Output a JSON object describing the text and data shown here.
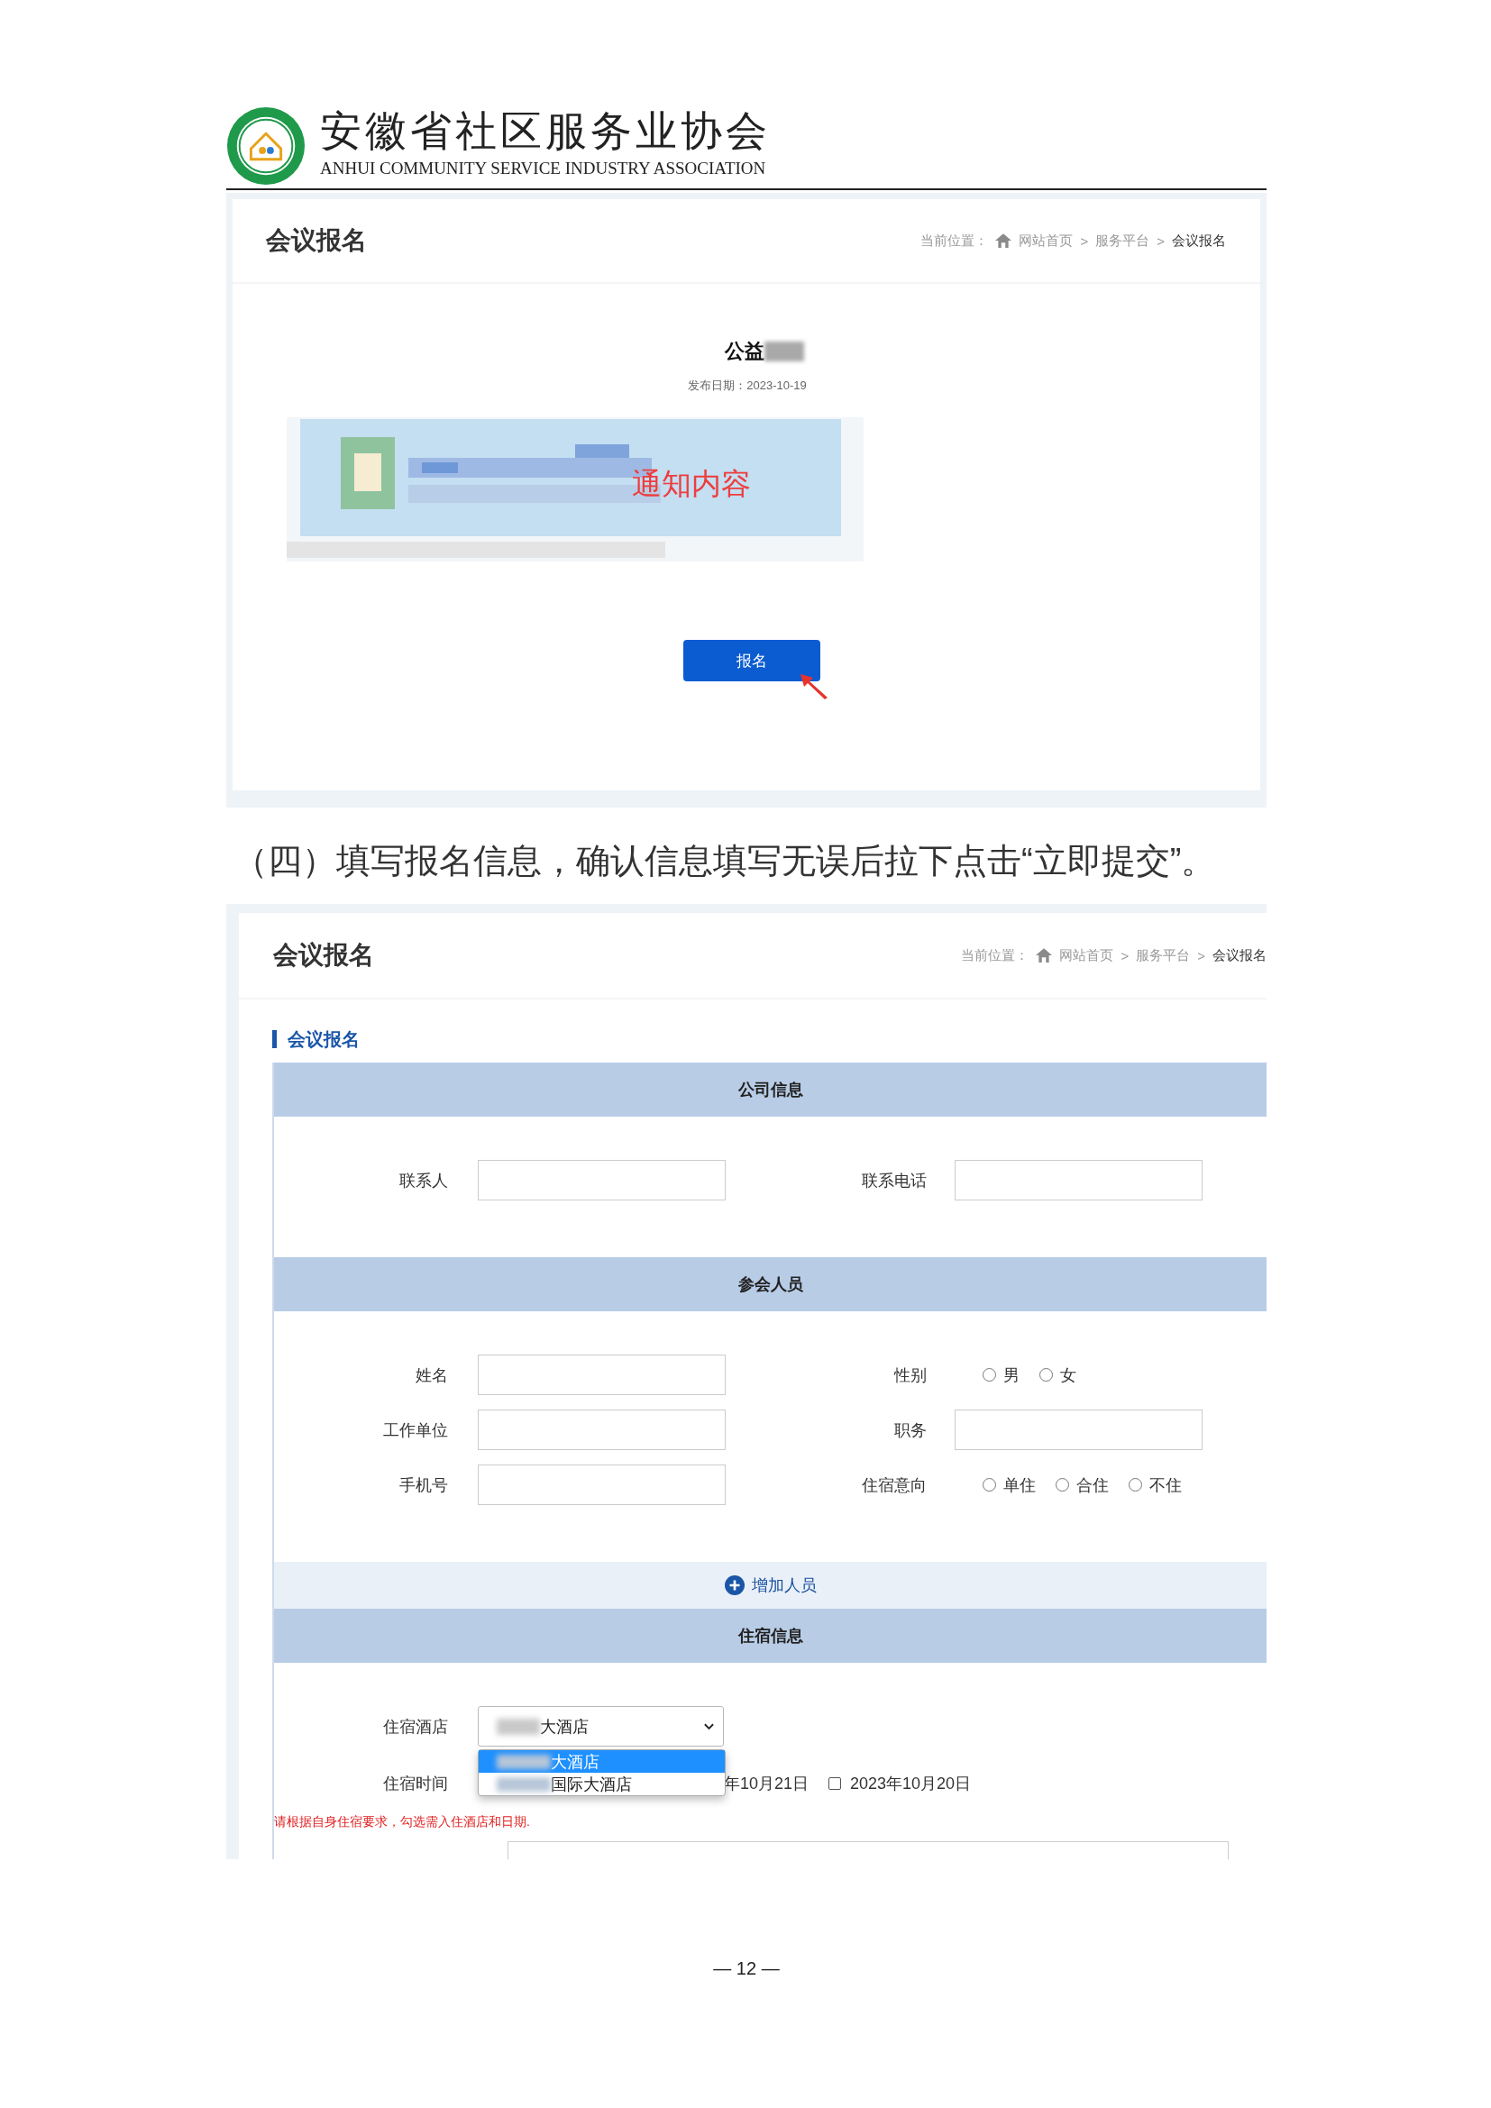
{
  "letterhead": {
    "name": "安徽省社区服务业协会",
    "name_en": "ANHUI COMMUNITY SERVICE INDUSTRY ASSOCIATION"
  },
  "notice_page": {
    "title": "会议报名",
    "breadcrumb": {
      "prefix": "当前位置：",
      "items": [
        "网站首页",
        "服务平台",
        "会议报名"
      ],
      "separator": ">"
    },
    "article_title": "公益",
    "date": "发布日期：2023-10-19",
    "overlay_label": "通知内容",
    "button": "报名"
  },
  "instruction": "（四）填写报名信息，确认信息填写无误后拉下点击“立即提交”。",
  "form_page": {
    "title": "会议报名",
    "breadcrumb": {
      "prefix": "当前位置：",
      "items": [
        "网站首页",
        "服务平台",
        "会议报名"
      ],
      "separator": ">"
    },
    "section_title": "会议报名",
    "sections": [
      {
        "title": "公司信息",
        "rows": [
          [
            {
              "kind": "text",
              "label": "联系人"
            },
            {
              "kind": "text",
              "label": "联系电话"
            }
          ]
        ]
      },
      {
        "title": "参会人员",
        "rows": [
          [
            {
              "kind": "text",
              "label": "姓名"
            },
            {
              "kind": "radio",
              "label": "性别",
              "options": [
                {
                  "label": "男",
                  "selected": false
                },
                {
                  "label": "女",
                  "selected": false
                }
              ]
            }
          ],
          [
            {
              "kind": "text",
              "label": "工作单位"
            },
            {
              "kind": "text",
              "label": "职务"
            }
          ],
          [
            {
              "kind": "text",
              "label": "手机号"
            },
            {
              "kind": "radio",
              "label": "住宿意向",
              "options": [
                {
                  "label": "单住",
                  "selected": false
                },
                {
                  "label": "合住",
                  "selected": false
                },
                {
                  "label": "不住",
                  "selected": false
                }
              ]
            }
          ]
        ]
      }
    ],
    "add_button": "增加人员",
    "lodging": {
      "title": "住宿信息",
      "hotel_label": "住宿酒店",
      "hotel_value": "大酒店",
      "hotel_options": [
        {
          "label": "大酒店",
          "selected": true
        },
        {
          "label": "国际大酒店",
          "selected": false
        }
      ],
      "date_label": "住宿时间",
      "dates": [
        {
          "label": "年10月21日"
        },
        {
          "label": "2023年10月20日",
          "checked": false
        }
      ],
      "note": "请根据自身住宿要求，勾选需入住酒店和日期."
    }
  },
  "page_number": "— 12 —"
}
